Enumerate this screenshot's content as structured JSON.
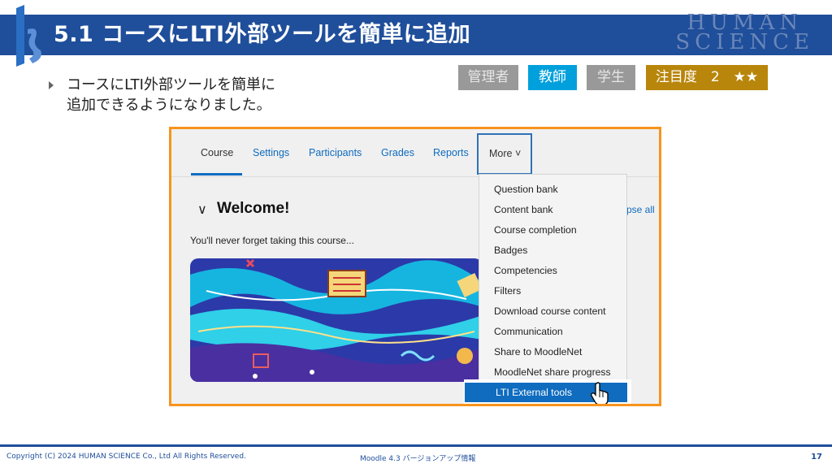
{
  "header": {
    "title": "5.1 コースにLTI外部ツールを簡単に追加",
    "brand_line1": "HUMAN",
    "brand_line2": "SCIENCE"
  },
  "bullet": {
    "line1": "コースにLTI外部ツールを簡単に",
    "line2": "追加できるようになりました。"
  },
  "badges": {
    "admin": "管理者",
    "teacher": "教師",
    "student": "学生",
    "attention": "注目度　2　★★"
  },
  "screenshot": {
    "tabs": [
      "Course",
      "Settings",
      "Participants",
      "Grades",
      "Reports"
    ],
    "more_label": "More",
    "section_title": "Welcome!",
    "collapse_all": "pse all",
    "intro_text": "You'll never forget taking this course...",
    "menu_items": [
      "Question bank",
      "Content bank",
      "Course completion",
      "Badges",
      "Competencies",
      "Filters",
      "Download course content",
      "Communication",
      "Share to MoodleNet",
      "MoodleNet share progress"
    ],
    "menu_selected": "LTI External tools"
  },
  "footer": {
    "copyright": "Copyright (C) 2024 HUMAN SCIENCE Co., Ltd All Rights Reserved.",
    "doc_title": "Moodle 4.3 バージョンアップ情報",
    "page": "17"
  },
  "colors": {
    "header_blue": "#1f4e9b",
    "frame_orange": "#f7941d",
    "teacher_badge": "#00a0dc",
    "attention_badge": "#b8860b",
    "moodle_blue": "#0f6cbf"
  }
}
